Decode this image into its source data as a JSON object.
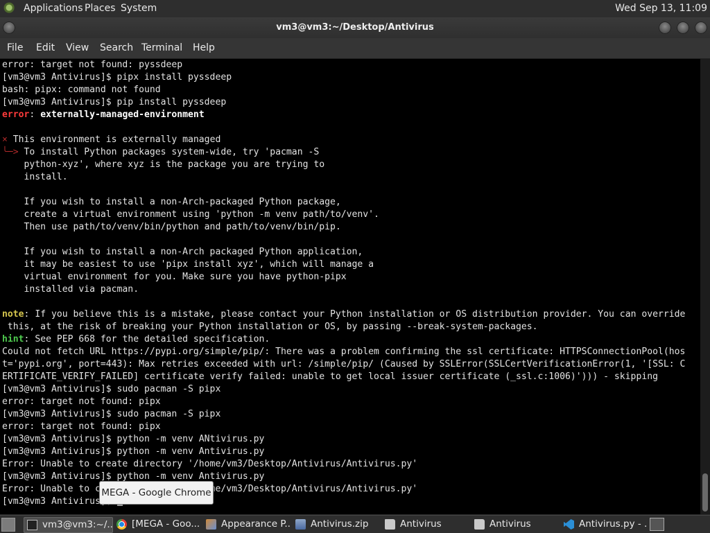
{
  "top_panel": {
    "menus": [
      "Applications",
      "Places",
      "System"
    ],
    "clock": "Wed Sep 13, 11:09"
  },
  "window": {
    "title": "vm3@vm3:~/Desktop/Antivirus"
  },
  "menubar": [
    "File",
    "Edit",
    "View",
    "Search",
    "Terminal",
    "Help"
  ],
  "terminal": {
    "lines": [
      "error: target not found: pyssdeep",
      "[vm3@vm3 Antivirus]$ pipx install pyssdeep",
      "bash: pipx: command not found",
      "[vm3@vm3 Antivirus]$ pip install pyssdeep",
      "error: externally-managed-environment",
      "",
      "× This environment is externally managed",
      "╰─> To install Python packages system-wide, try 'pacman -S",
      "    python-xyz', where xyz is the package you are trying to",
      "    install.",
      "",
      "    If you wish to install a non-Arch-packaged Python package,",
      "    create a virtual environment using 'python -m venv path/to/venv'.",
      "    Then use path/to/venv/bin/python and path/to/venv/bin/pip.",
      "",
      "    If you wish to install a non-Arch packaged Python application,",
      "    it may be easiest to use 'pipx install xyz', which will manage a",
      "    virtual environment for you. Make sure you have python-pipx",
      "    installed via pacman.",
      "",
      "note: If you believe this is a mistake, please contact your Python installation or OS distribution provider. You can override",
      " this, at the risk of breaking your Python installation or OS, by passing --break-system-packages.",
      "hint: See PEP 668 for the detailed specification.",
      "Could not fetch URL https://pypi.org/simple/pip/: There was a problem confirming the ssl certificate: HTTPSConnectionPool(hos",
      "t='pypi.org', port=443): Max retries exceeded with url: /simple/pip/ (Caused by SSLError(SSLCertVerificationError(1, '[SSL: C",
      "ERTIFICATE_VERIFY_FAILED] certificate verify failed: unable to get local issuer certificate (_ssl.c:1006)'))) - skipping",
      "[vm3@vm3 Antivirus]$ sudo pacman -S pipx",
      "error: target not found: pipx",
      "[vm3@vm3 Antivirus]$ sudo pacman -S pipx",
      "error: target not found: pipx",
      "[vm3@vm3 Antivirus]$ python -m venv ANtivirus.py",
      "[vm3@vm3 Antivirus]$ python -m venv Antivirus.py",
      "Error: Unable to create directory '/home/vm3/Desktop/Antivirus/Antivirus.py'",
      "[vm3@vm3 Antivirus]$ python -m venv Antivirus.py",
      "Error: Unable to create directory '/home/vm3/Desktop/Antivirus/Antivirus.py'",
      "[vm3@vm3 Antivirus]$ "
    ]
  },
  "tooltip": "MEGA - Google Chrome",
  "taskbar": {
    "tasks": [
      {
        "label": "vm3@vm3:~/...",
        "icon": "terminal-icon"
      },
      {
        "label": "[MEGA - Goo...",
        "icon": "chrome-icon"
      },
      {
        "label": "Appearance P...",
        "icon": "appearance-icon"
      },
      {
        "label": "Antivirus.zip",
        "icon": "archive-icon"
      },
      {
        "label": "Antivirus",
        "icon": "folder-icon"
      },
      {
        "label": "Antivirus",
        "icon": "folder-icon"
      },
      {
        "label": "Antivirus.py - ...",
        "icon": "vscode-icon"
      }
    ]
  },
  "colors": {
    "error": "#ff3b3b",
    "note": "#d6c64e",
    "hint": "#4ec94e",
    "terminal_bg": "#000000"
  }
}
